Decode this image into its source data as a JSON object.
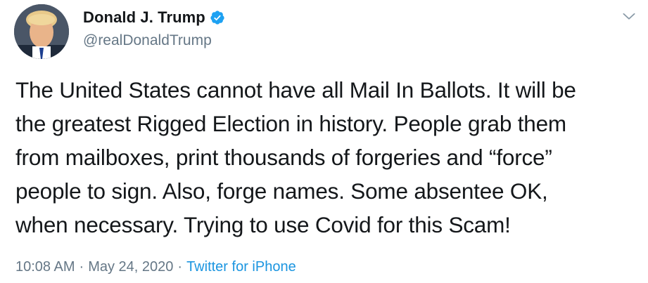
{
  "author": {
    "display_name": "Donald J. Trump",
    "handle": "@realDonaldTrump",
    "verified": true,
    "verified_color": "#1da1f2"
  },
  "tweet": {
    "lines": [
      "The United States cannot have all Mail In Ballots. It will be",
      "the greatest Rigged Election in history. People grab them",
      "from mailboxes, print thousands of forgeries and “force”",
      "people to sign. Also, forge names. Some absentee OK,",
      "when necessary. Trying to use Covid for this Scam!"
    ]
  },
  "meta": {
    "time": "10:08 AM",
    "separator": "·",
    "date": "May 24, 2020",
    "source": "Twitter for iPhone"
  },
  "colors": {
    "text": "#14171a",
    "secondary": "#657786",
    "link": "#1b95e0"
  },
  "icons": {
    "avatar": "profile-photo",
    "verified": "verified-badge-icon",
    "menu": "chevron-down-icon"
  }
}
